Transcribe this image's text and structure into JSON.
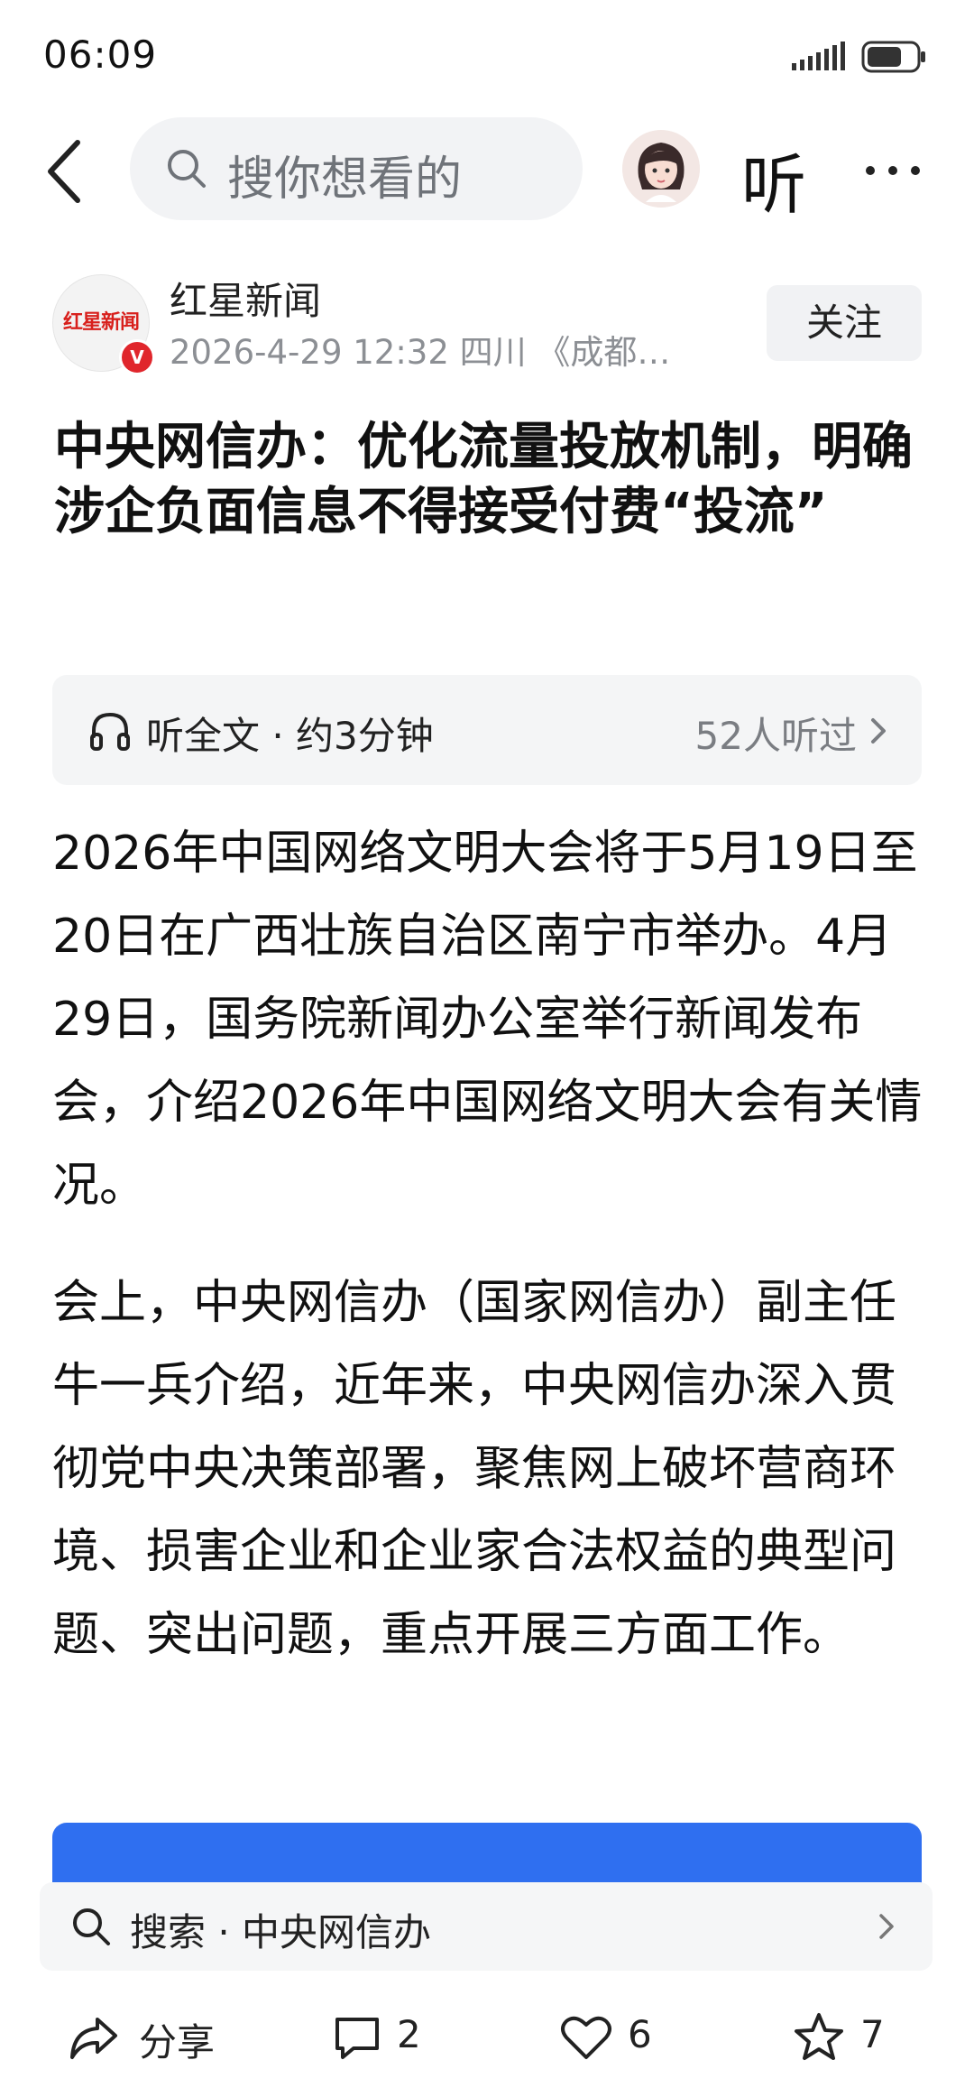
{
  "status_bar": {
    "time": "06:09",
    "battery_level": 0.72
  },
  "top_nav": {
    "back_icon": "chevron-left-icon",
    "search_placeholder": "搜你想看的",
    "listen_label": "听",
    "more_icon": "more-horizontal-icon"
  },
  "article": {
    "source_name": "红星新闻",
    "source_logo_text": "红星新闻",
    "source_meta": "2026-4-29  12:32  四川  《成都…",
    "follow_label": "关注",
    "verified_badge": "V",
    "title": "中央网信办：优化流量投放机制，明确涉企负面信息不得接受付费“投流”",
    "listen_bar": {
      "label": "听全文 · 约3分钟",
      "count": "52人听过"
    },
    "paragraphs": [
      "2026年中国网络文明大会将于5月19日至20日在广西壮族自治区南宁市举办。4月29日，国务院新闻办公室举行新闻发布会，介绍2026年中国网络文明大会有关情况。",
      "会上，中央网信办（国家网信办）副主任牛一兵介绍，近年来，中央网信办深入贯彻党中央决策部署，聚焦网上破坏营商环境、损害企业和企业家合法权益的典型问题、突出问题，重点开展三方面工作。"
    ]
  },
  "search_suggestion": {
    "text": "搜索 · 中央网信办"
  },
  "bottom_bar": {
    "share_label": "分享",
    "comment_count": "2",
    "like_count": "6",
    "favorite_count": "7"
  },
  "colors": {
    "accent_blue": "#2f6ff0",
    "brand_red": "#d8201c",
    "meta_gray": "#8c8f94"
  }
}
